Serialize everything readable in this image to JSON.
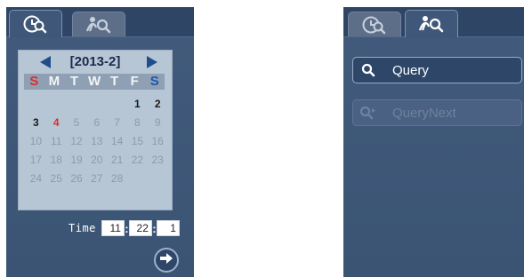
{
  "left_panel": {
    "tabs": [
      {
        "icon": "clock-search-icon",
        "active": true
      },
      {
        "icon": "person-search-icon",
        "active": false
      }
    ],
    "calendar": {
      "title": "[2013-2]",
      "weekdays": [
        "S",
        "M",
        "T",
        "W",
        "T",
        "F",
        "S"
      ],
      "weekday_colors": [
        "#d83030",
        "#f4f4f4",
        "#f4f4f4",
        "#f4f4f4",
        "#f4f4f4",
        "#f4f4f4",
        "#1f57a8"
      ],
      "weeks": [
        [
          "",
          "",
          "",
          "",
          "",
          "1",
          "2"
        ],
        [
          "3",
          "4",
          "5",
          "6",
          "7",
          "8",
          "9"
        ],
        [
          "10",
          "11",
          "12",
          "13",
          "14",
          "15",
          "16"
        ],
        [
          "17",
          "18",
          "19",
          "20",
          "21",
          "22",
          "23"
        ],
        [
          "24",
          "25",
          "26",
          "27",
          "28",
          "",
          ""
        ]
      ],
      "available_days": [
        "1",
        "2",
        "3"
      ],
      "highlight_day": "4"
    },
    "time": {
      "label": "Time",
      "hour": "11",
      "minute": "22",
      "second": "1",
      "separator": ":"
    }
  },
  "right_panel": {
    "tabs": [
      {
        "icon": "clock-search-icon",
        "active": false
      },
      {
        "icon": "person-search-icon",
        "active": true
      }
    ],
    "query_button": {
      "label": "Query",
      "enabled": true
    },
    "querynext_button": {
      "label": "QueryNext",
      "enabled": false
    }
  },
  "colors": {
    "panel": "#3f5879",
    "calendar_bg": "#b7c6d4",
    "today": "#e02a2a"
  }
}
